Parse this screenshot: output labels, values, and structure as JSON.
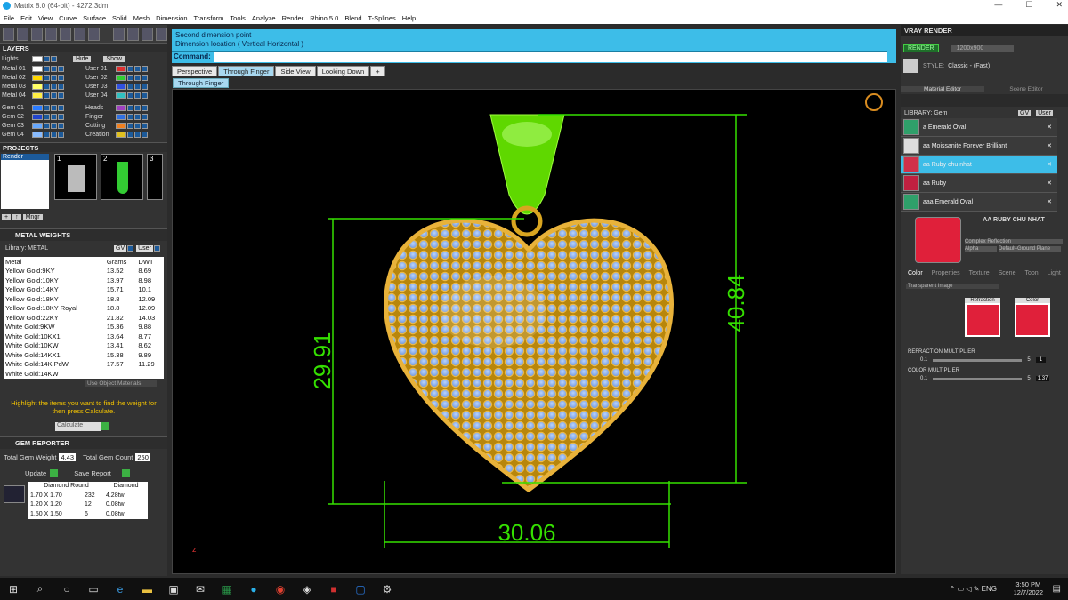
{
  "window": {
    "title": "Matrix 8.0 (64-bit) - 4272.3dm",
    "controls": [
      "—",
      "☐",
      "✕"
    ]
  },
  "menu": [
    "File",
    "Edit",
    "View",
    "Curve",
    "Surface",
    "Solid",
    "Mesh",
    "Dimension",
    "Transform",
    "Tools",
    "Analyze",
    "Render",
    "Rhino 5.0",
    "Blend",
    "T-Splines",
    "Help"
  ],
  "layers": {
    "title": "LAYERS",
    "lights": "Lights",
    "hide": "Hide",
    "show": "Show",
    "left": [
      {
        "n": "Metal 01",
        "c": "#ffffff"
      },
      {
        "n": "Metal 02",
        "c": "#ffd700"
      },
      {
        "n": "Metal 03",
        "c": "#ffff66"
      },
      {
        "n": "Metal 04",
        "c": "#ffee44"
      },
      {
        "n": "Gem 01",
        "c": "#2b7cff"
      },
      {
        "n": "Gem 02",
        "c": "#2244cc"
      },
      {
        "n": "Gem 03",
        "c": "#66a8ff"
      },
      {
        "n": "Gem 04",
        "c": "#88bbff"
      }
    ],
    "right": [
      {
        "n": "User 01",
        "c": "#e03030"
      },
      {
        "n": "User 02",
        "c": "#30d030"
      },
      {
        "n": "User 03",
        "c": "#3050e0"
      },
      {
        "n": "User 04",
        "c": "#30c0c0"
      },
      {
        "n": "Heads",
        "c": "#a040c0"
      },
      {
        "n": "Finger",
        "c": "#3070e0"
      },
      {
        "n": "Cutting",
        "c": "#f08020"
      },
      {
        "n": "Creation",
        "c": "#e0c020"
      }
    ]
  },
  "projects": {
    "title": "PROJECTS",
    "item": "Render",
    "mngr": "Mngr",
    "thumbs": [
      "1",
      "2",
      "3"
    ]
  },
  "metal_weights": {
    "title": "METAL WEIGHTS",
    "library": "Library: METAL",
    "gv": "GV",
    "user": "User",
    "cols": [
      "Metal",
      "Grams",
      "DWT"
    ],
    "rows": [
      [
        "Yellow Gold:9KY",
        "13.52",
        "8.69"
      ],
      [
        "Yellow Gold:10KY",
        "13.97",
        "8.98"
      ],
      [
        "Yellow Gold:14KY",
        "15.71",
        "10.1"
      ],
      [
        "Yellow Gold:18KY",
        "18.8",
        "12.09"
      ],
      [
        "Yellow Gold:18KY Royal",
        "18.8",
        "12.09"
      ],
      [
        "Yellow Gold:22KY",
        "21.82",
        "14.03"
      ],
      [
        "White Gold:9KW",
        "15.36",
        "9.88"
      ],
      [
        "White Gold:10KX1",
        "13.64",
        "8.77"
      ],
      [
        "White Gold:10KW",
        "13.41",
        "8.62"
      ],
      [
        "White Gold:14KX1",
        "15.38",
        "9.89"
      ],
      [
        "White Gold:14K PdW",
        "17.57",
        "11.29"
      ],
      [
        "White Gold:14KW",
        "",
        ""
      ]
    ],
    "use_object": "Use Object Materials",
    "hint": "Highlight the items you want to find the weight for then press Calculate.",
    "calculate": "Calculate"
  },
  "gem_reporter": {
    "title": "GEM REPORTER",
    "tgw_label": "Total Gem Weight",
    "tgw": "4.43",
    "tgc_label": "Total Gem Count",
    "tgc": "250",
    "update": "Update",
    "save": "Save Report",
    "cols": [
      "Diamond Round",
      "Diamond"
    ],
    "rows": [
      [
        "1.70 X 1.70",
        "232",
        "4.28tw"
      ],
      [
        "1.20 X 1.20",
        "12",
        "0.08tw"
      ],
      [
        "1.50 X 1.50",
        "6",
        "0.08tw"
      ]
    ]
  },
  "command": {
    "line1": "Second dimension point",
    "line2": "Dimension location ( Vertical  Horizontal )",
    "label": "Command:"
  },
  "tabs": [
    "Perspective",
    "Through Finger",
    "Side View",
    "Looking Down",
    "+"
  ],
  "subtab": "Through Finger",
  "dimensions": {
    "height": "40.84",
    "side": "29.91",
    "width": "30.06"
  },
  "vray": {
    "title": "VRAY RENDER",
    "render": "RENDER",
    "size": "1200x900",
    "style_label": "STYLE:",
    "style": "Classic - (Fast)",
    "tabs": [
      "Material Editor",
      "Scene Editor"
    ],
    "library": "LIBRARY: Gem",
    "gv": "GV",
    "user": "User",
    "items": [
      {
        "n": "a Emerald Oval",
        "c": "#2fa06a"
      },
      {
        "n": "aa Moissanite Forever Brilliant",
        "c": "#dddddd"
      },
      {
        "n": "aa Ruby chu nhat",
        "c": "#d0304a"
      },
      {
        "n": "aa Ruby",
        "c": "#c02040"
      },
      {
        "n": "aaa Emerald Oval",
        "c": "#2fa06a"
      }
    ],
    "selected_name": "AA RUBY CHU NHAT",
    "complex": "Complex Reflection",
    "alpha": "Alpha",
    "ground": "Default-Ground Plane",
    "proptabs": [
      "Color",
      "Properties",
      "Texture",
      "Scene",
      "Toon",
      "Light"
    ],
    "transparent": "Transparent Image",
    "refraction": "Refraction",
    "color": "Color",
    "refr_mult": "REFRACTION MULTIPLIER",
    "refr_min": "0.1",
    "refr_max": "5",
    "refr_val": "1",
    "col_mult": "COLOR MULTIPLIER",
    "col_min": "0.1",
    "col_max": "5",
    "col_val": "1.37"
  },
  "taskbar": {
    "time": "3:50 PM",
    "date": "12/7/2022",
    "lang": "ENG"
  }
}
